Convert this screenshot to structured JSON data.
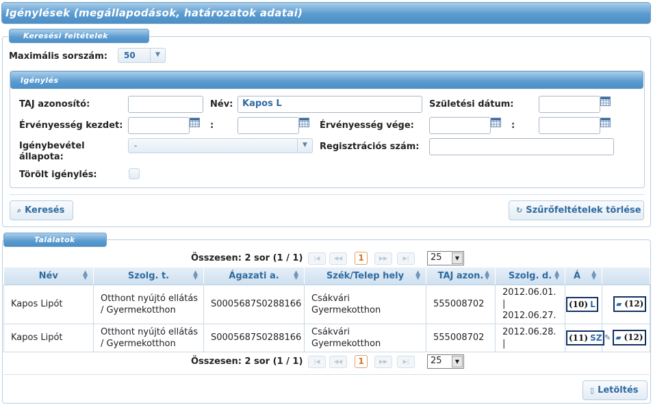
{
  "page": {
    "title": "Igénylések (megállapodások, határozatok adatai)"
  },
  "search": {
    "legend": "Keresési feltételek",
    "max_row_label": "Maximális sorszám:",
    "max_row_value": "50",
    "sub_legend": "Igénylés",
    "taj_label": "TAJ azonosító:",
    "taj_value": "",
    "name_label": "Név:",
    "name_value": "Kapos L",
    "birth_label": "Születési dátum:",
    "valid_start_label": "Érvényesség kezdet:",
    "range_separator": ":",
    "valid_end_label": "Érvényesség vége:",
    "status_label_1": "Igénybevétel",
    "status_label_2": "állapota:",
    "status_value": "-",
    "reg_label": "Regisztrációs szám:",
    "deleted_label": "Törölt igénylés:",
    "search_button": "Keresés",
    "clear_button": "Szűrőfeltételek törlése"
  },
  "results": {
    "legend": "Találatok",
    "pager": {
      "total": "Összesen: 2 sor (1 / 1)",
      "page": "1",
      "page_size": "25"
    },
    "columns": [
      "Név",
      "Szolg. t.",
      "Ágazati a.",
      "Szék/Telep hely",
      "TAJ azon.",
      "Szolg. d.",
      "Á"
    ],
    "rows": [
      {
        "name": "Kapos Lipót",
        "service_1": "Otthont nyújtó ellátás",
        "service_2": "/ Gyermekotthon",
        "sector": "S0005687S0288166",
        "site_1": "Csákvári",
        "site_2": "Gyermekotthon",
        "taj": "555008702",
        "date_1": "2012.06.01.",
        "date_2": "|",
        "date_3": "2012.06.27.",
        "state_num": "(10)",
        "state_val": "L",
        "action_num": "(12)"
      },
      {
        "name": "Kapos Lipót",
        "service_1": "Otthont nyújtó ellátás",
        "service_2": "/ Gyermekotthon",
        "sector": "S0005687S0288166",
        "site_1": "Csákvári",
        "site_2": "Gyermekotthon",
        "taj": "555008702",
        "date_1": "2012.06.28.",
        "date_2": "|",
        "state_num": "(11)",
        "state_val": "SZ",
        "action_num": "(12)"
      }
    ],
    "download_button": "Letöltés"
  }
}
